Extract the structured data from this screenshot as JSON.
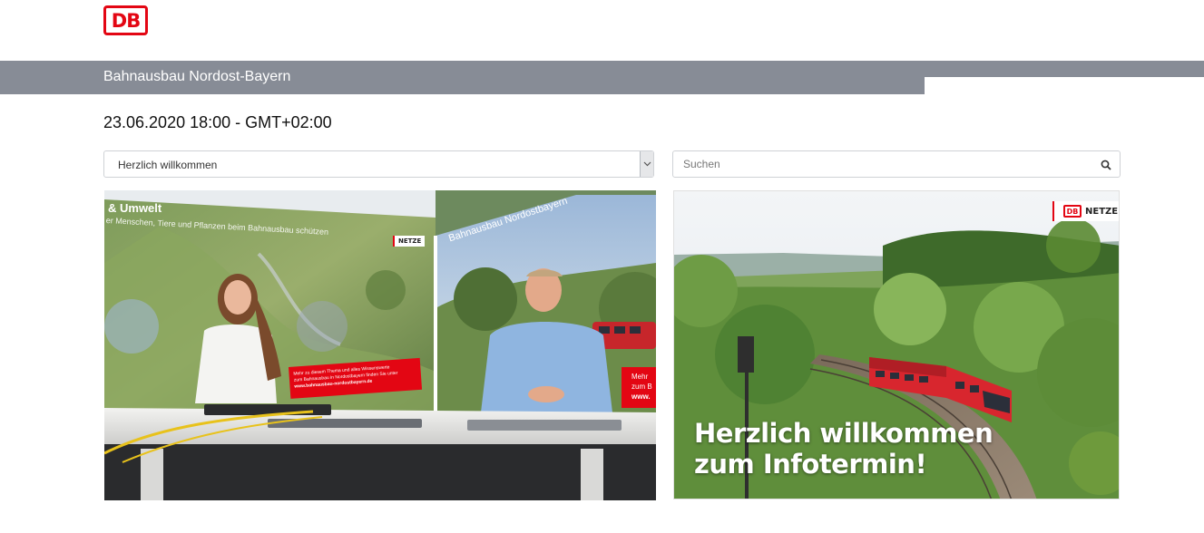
{
  "brand": {
    "logo_text": "DB",
    "color": "#e30613"
  },
  "header": {
    "title": "Bahnausbau Nordost-Bayern",
    "bar_color": "#878c96"
  },
  "event": {
    "datetime": "23.06.2020 18:00 - GMT+02:00"
  },
  "controls": {
    "session_select": {
      "selected": "Herzlich willkommen",
      "icon": "chevron-down-icon"
    },
    "search": {
      "placeholder": "Suchen",
      "value": "",
      "icon": "search-icon"
    }
  },
  "video": {
    "backdrop_left_heading": "& Umwelt",
    "backdrop_left_subline": "er Menschen, Tiere und Pflanzen beim Bahnausbau schützen",
    "backdrop_right_heading": "Bahnausbau Nordostbayern",
    "banner_line1": "Mehr zu diesem Thema und alles Wissenswerte",
    "banner_line2": "zum Bahnausbau in Nordostbayern finden Sie unter",
    "banner_url": "www.bahnausbau-nordostbayern.de",
    "banner_right_line1": "Mehr",
    "banner_right_line2": "zum B",
    "banner_right_line3": "www.",
    "badge_text": "NETZE"
  },
  "slide": {
    "badge_logo": "DB",
    "badge_text": "NETZE",
    "headline_line1": "Herzlich willkommen",
    "headline_line2": "zum Infotermin!"
  }
}
